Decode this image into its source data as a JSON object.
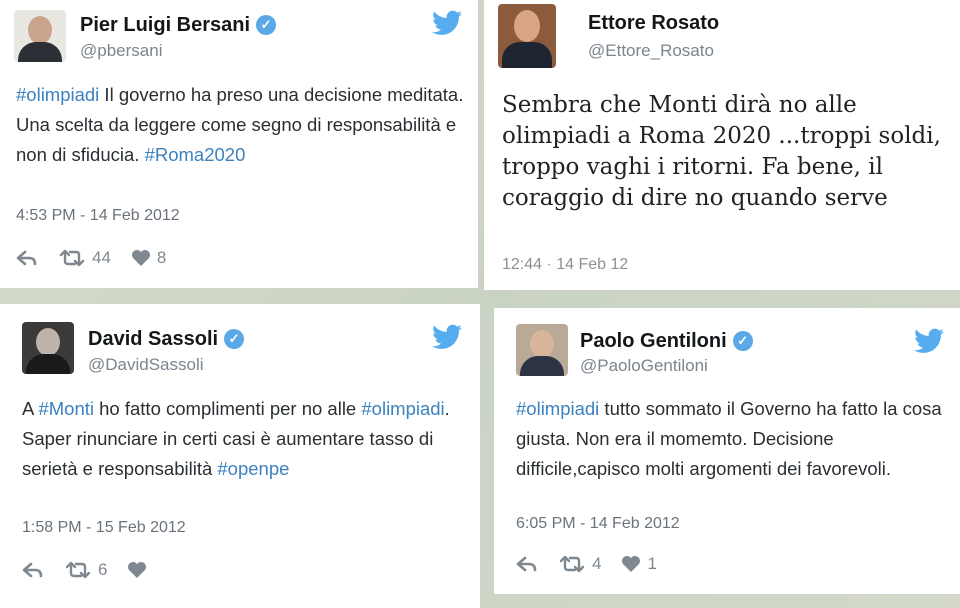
{
  "tweets": [
    {
      "name": "Pier Luigi Bersani",
      "handle": "@pbersani",
      "verified": true,
      "text_parts": [
        {
          "t": "#olimpiadi",
          "tag": true
        },
        {
          "t": " Il governo ha preso una decisione meditata. Una scelta da leggere come segno di responsabilità e non di sfiducia. ",
          "tag": false
        },
        {
          "t": "#Roma2020",
          "tag": true
        }
      ],
      "timestamp": "4:53 PM - 14 Feb 2012",
      "retweets": "44",
      "likes": "8"
    },
    {
      "name": "Ettore Rosato",
      "handle": "@Ettore_Rosato",
      "verified": false,
      "text": "Sembra che Monti dirà no alle olimpiadi a Roma 2020 ...troppi soldi, troppo vaghi i ritorni. Fa bene, il coraggio di dire no quando serve",
      "timestamp": "12:44 · 14 Feb 12"
    },
    {
      "name": "David Sassoli",
      "handle": "@DavidSassoli",
      "verified": true,
      "text_parts": [
        {
          "t": "A ",
          "tag": false
        },
        {
          "t": "#Monti",
          "tag": true
        },
        {
          "t": " ho fatto complimenti per no alle ",
          "tag": false
        },
        {
          "t": "#olimpiadi",
          "tag": true
        },
        {
          "t": ". Saper rinunciare in certi casi è aumentare tasso di serietà e responsabilità ",
          "tag": false
        },
        {
          "t": "#openpe",
          "tag": true
        }
      ],
      "timestamp": "1:58 PM - 15 Feb 2012",
      "retweets": "6",
      "likes": ""
    },
    {
      "name": "Paolo Gentiloni",
      "handle": "@PaoloGentiloni",
      "verified": true,
      "text_parts": [
        {
          "t": "#olimpiadi",
          "tag": true
        },
        {
          "t": " tutto sommato il Governo ha fatto la cosa giusta. Non era il momemto. Decisione difficile,capisco molti argomenti dei favorevoli.",
          "tag": false
        }
      ],
      "timestamp": "6:05 PM - 14 Feb 2012",
      "retweets": "4",
      "likes": "1"
    }
  ],
  "icons": {
    "brand_color": "#55acee",
    "hashtag_color": "#3c81c0"
  }
}
